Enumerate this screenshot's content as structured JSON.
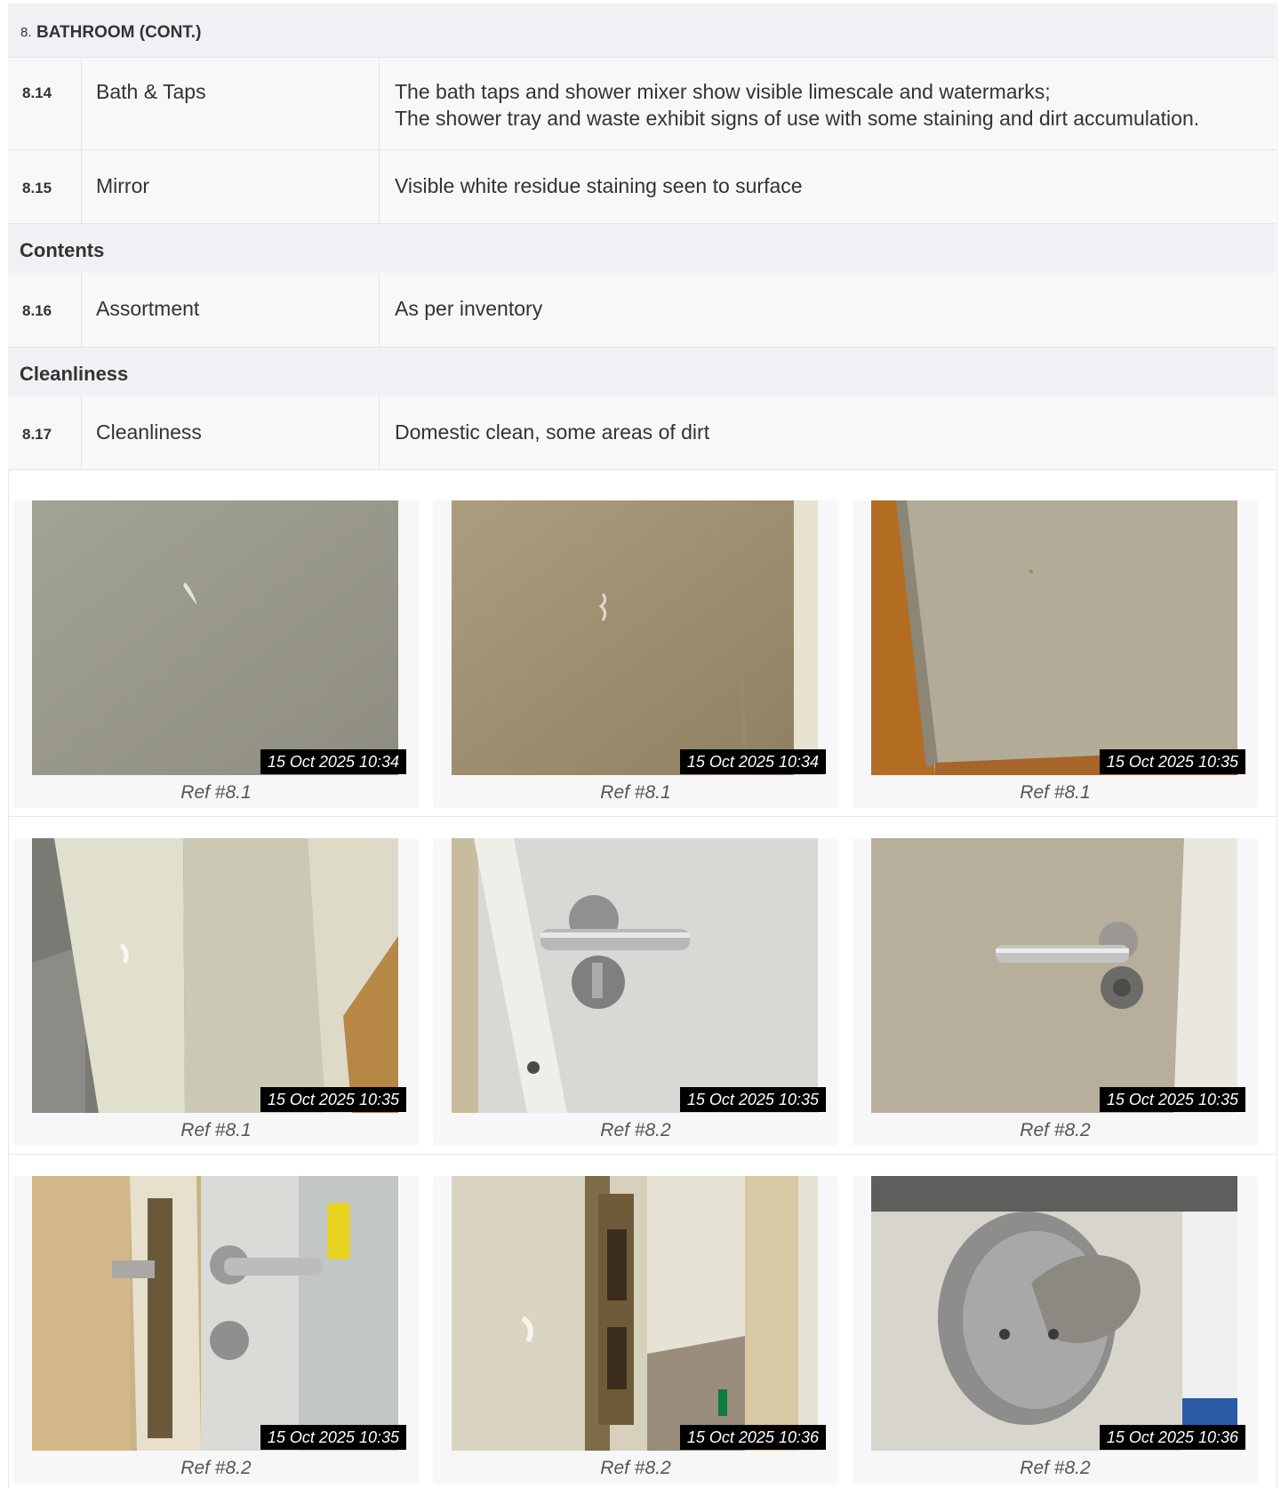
{
  "section": {
    "number": "8.",
    "title": "BATHROOM (CONT.)"
  },
  "rows": [
    {
      "ref": "8.14",
      "label": "Bath & Taps",
      "lines": [
        "The bath taps and shower mixer show visible limescale and watermarks;",
        "The shower tray and waste exhibit signs of use with some staining and dirt accumulation."
      ]
    },
    {
      "ref": "8.15",
      "label": "Mirror",
      "lines": [
        "Visible white residue staining seen to surface"
      ]
    },
    {
      "ref": "8.16",
      "label": "Assortment",
      "lines": [
        "As per inventory"
      ]
    },
    {
      "ref": "8.17",
      "label": "Cleanliness",
      "lines": [
        "Domestic clean, some areas of dirt"
      ]
    }
  ],
  "subheaders": {
    "contents": "Contents",
    "cleanliness": "Cleanliness"
  },
  "photos": [
    {
      "timestamp": "15 Oct 2025 10:34",
      "ref": "Ref #8.1",
      "subject": "grey-wall-scuff"
    },
    {
      "timestamp": "15 Oct 2025 10:34",
      "ref": "Ref #8.1",
      "subject": "beige-wall-corner"
    },
    {
      "timestamp": "15 Oct 2025 10:35",
      "ref": "Ref #8.1",
      "subject": "wall-base-wood-floor"
    },
    {
      "timestamp": "15 Oct 2025 10:35",
      "ref": "Ref #8.1",
      "subject": "door-frame-chips"
    },
    {
      "timestamp": "15 Oct 2025 10:35",
      "ref": "Ref #8.2",
      "subject": "door-lever-handle"
    },
    {
      "timestamp": "15 Oct 2025 10:35",
      "ref": "Ref #8.2",
      "subject": "door-lever-handle-close"
    },
    {
      "timestamp": "15 Oct 2025 10:35",
      "ref": "Ref #8.2",
      "subject": "door-edge-latch"
    },
    {
      "timestamp": "15 Oct 2025 10:36",
      "ref": "Ref #8.2",
      "subject": "door-strike-plate"
    },
    {
      "timestamp": "15 Oct 2025 10:36",
      "ref": "Ref #8.2",
      "subject": "thumb-turn-closeup"
    }
  ],
  "colors": {
    "header_bg": "#f0f1f5",
    "row_bg": "#f8f8fb",
    "border": "#e3e4ea",
    "timestamp_bg": "#000000"
  }
}
